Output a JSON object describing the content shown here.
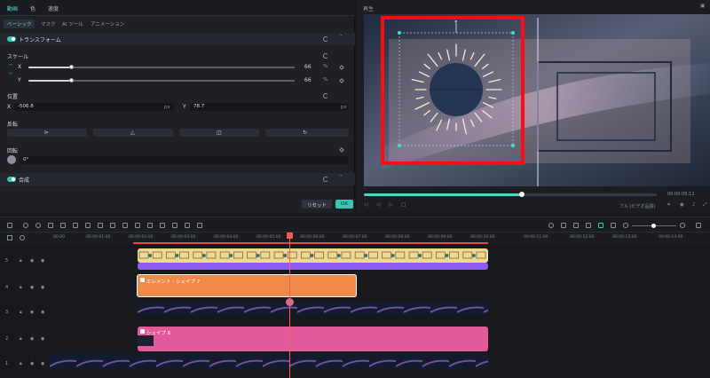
{
  "left_panel": {
    "tabs": [
      "動画",
      "色",
      "速度"
    ],
    "subtabs": [
      "ベーシック",
      "マスク",
      "AI ツール",
      "アニメーション"
    ],
    "transform": {
      "title": "トランスフォーム",
      "scale_label": "スケール",
      "x_label": "X",
      "y_label": "Y",
      "scale_x": "66",
      "scale_y": "66",
      "unit_pct": "%",
      "position_label": "位置",
      "pos_x_label": "X",
      "pos_x": "-506.8",
      "pos_y_label": "Y",
      "pos_y": "78.7",
      "unit_px": "px",
      "flip_label": "反転",
      "rotate_label": "回転",
      "rotate_value": "0°"
    },
    "composite_title": "合成",
    "reset_button": "リセット",
    "ok_button": "OK"
  },
  "preview": {
    "title": "再生",
    "time": "00:00:05:12",
    "quality": "フル (ビデオ品質)"
  },
  "timeline": {
    "ruler": [
      "00:00",
      "00:00:01:00",
      "00:00:02:00",
      "00:00:03:00",
      "00:00:04:00",
      "00:00:05:00",
      "00:00:06:00",
      "00:00:07:00",
      "00:00:08:00",
      "00:00:09:00",
      "00:00:10:00",
      "00:00:11:00",
      "00:00:12:00",
      "00:00:13:00",
      "00:00:14:00"
    ],
    "tracks": [
      "5",
      "4",
      "3",
      "2",
      "1"
    ],
    "clip_orange": "エレメント・シェイプ 7",
    "clip_pink": "シェイプ 6"
  },
  "colors": {
    "accent": "#35c6b6",
    "selection": "#ff0a14",
    "orange_clip": "#f08a4b",
    "pink_clip": "#e15a9a",
    "purple_clip": "#8c5cf2"
  }
}
